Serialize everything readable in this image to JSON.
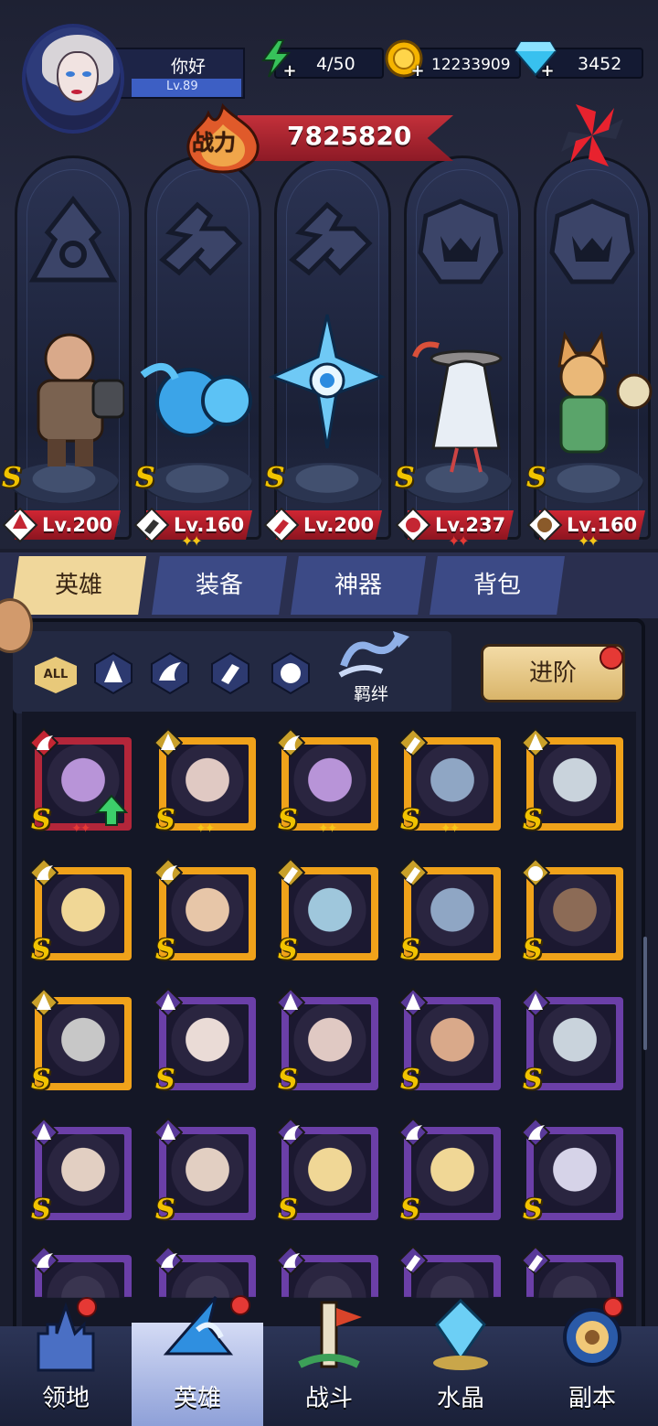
{
  "player": {
    "name": "你好",
    "level": "Lv.89"
  },
  "resources": {
    "energy": {
      "icon": "lightning-icon",
      "value": "4/50"
    },
    "gold": {
      "icon": "gold-coin-icon",
      "value": "12233909"
    },
    "diamond": {
      "icon": "diamond-icon",
      "value": "3452"
    }
  },
  "power": {
    "label": "战力",
    "value": "7825820"
  },
  "team": [
    {
      "slot_icon": "warrior-class-icon",
      "level": "Lv.200",
      "class_icon": "mage-class-icon",
      "stars": 0,
      "star_color": "#f5c518"
    },
    {
      "slot_icon": "engineer-class-icon",
      "level": "Lv.160",
      "class_icon": "wrench-class-icon",
      "stars": 2,
      "star_color": "#f5c518"
    },
    {
      "slot_icon": "engineer-class-icon",
      "level": "Lv.200",
      "class_icon": "wrench-class-icon",
      "stars": 0,
      "star_color": "#f5c518"
    },
    {
      "slot_icon": "beast-class-icon",
      "level": "Lv.237",
      "class_icon": "beast-class-icon",
      "stars": 2,
      "star_color": "#e53935"
    },
    {
      "slot_icon": "beast-class-icon",
      "level": "Lv.160",
      "class_icon": "beast-class-icon",
      "stars": 2,
      "star_color": "#f5c518"
    }
  ],
  "tabs": [
    {
      "label": "英雄",
      "active": true
    },
    {
      "label": "装备",
      "active": false
    },
    {
      "label": "神器",
      "active": false
    },
    {
      "label": "背包",
      "active": false
    }
  ],
  "filters": {
    "all_label": "ALL",
    "icons": [
      "mage-filter-icon",
      "wing-filter-icon",
      "wrench-filter-icon",
      "beast-filter-icon"
    ]
  },
  "bond_label": "羁绊",
  "advance_label": "进阶",
  "heroes": [
    {
      "name": "purple-hair-woman-portrait",
      "frame": "#b3263a",
      "class_icon": "wing-class-icon",
      "stars": 2,
      "star_color": "#e53935",
      "upgrade": true,
      "skin": "#b894d8"
    },
    {
      "name": "masked-ninja-woman-portrait",
      "frame": "#f0a21a",
      "class_icon": "mage-class-icon",
      "stars": 2,
      "star_color": "#f5c518",
      "upgrade": false,
      "skin": "#e0c9c3"
    },
    {
      "name": "purple-hair-woman-portrait",
      "frame": "#f0a21a",
      "class_icon": "wing-class-icon",
      "stars": 2,
      "star_color": "#f5c518",
      "upgrade": false,
      "skin": "#b894d8"
    },
    {
      "name": "robot-mech-portrait",
      "frame": "#f0a21a",
      "class_icon": "wrench-class-icon",
      "stars": 2,
      "star_color": "#f5c518",
      "upgrade": false,
      "skin": "#8fa6c4"
    },
    {
      "name": "silver-hair-man-portrait",
      "frame": "#f0a21a",
      "class_icon": "mage-class-icon",
      "stars": 0,
      "star_color": "#f5c518",
      "upgrade": false,
      "skin": "#c9d3dc"
    },
    {
      "name": "golden-elf-portrait",
      "frame": "#f0a21a",
      "class_icon": "wing-class-icon",
      "stars": 0,
      "star_color": "#f5c518",
      "upgrade": false,
      "skin": "#f0d796"
    },
    {
      "name": "green-hair-elf-portrait",
      "frame": "#f0a21a",
      "class_icon": "wing-class-icon",
      "stars": 0,
      "star_color": "#f5c518",
      "upgrade": false,
      "skin": "#e7c6a8"
    },
    {
      "name": "cyan-robot-portrait",
      "frame": "#f0a21a",
      "class_icon": "wrench-class-icon",
      "stars": 0,
      "star_color": "#f5c518",
      "upgrade": false,
      "skin": "#9fc7dc"
    },
    {
      "name": "robot-mech-portrait",
      "frame": "#f0a21a",
      "class_icon": "wrench-class-icon",
      "stars": 0,
      "star_color": "#f5c518",
      "upgrade": false,
      "skin": "#8fa6c4"
    },
    {
      "name": "ufo-saucer-portrait",
      "frame": "#f0a21a",
      "class_icon": "beast-class-icon",
      "stars": 0,
      "star_color": "#f5c518",
      "upgrade": false,
      "skin": "#8c6b56"
    },
    {
      "name": "armored-knight-portrait",
      "frame": "#f0a21a",
      "class_icon": "mage-class-icon",
      "stars": 0,
      "star_color": "#f5c518",
      "upgrade": false,
      "skin": "#c7c7c7"
    },
    {
      "name": "horned-white-hair-woman-portrait",
      "frame": "#6b3fa8",
      "class_icon": "mage-class-icon",
      "stars": 0,
      "star_color": "#f5c518",
      "upgrade": false,
      "skin": "#eadbd6"
    },
    {
      "name": "masked-ninja-woman-portrait",
      "frame": "#6b3fa8",
      "class_icon": "mage-class-icon",
      "stars": 0,
      "star_color": "#f5c518",
      "upgrade": false,
      "skin": "#e0c9c3"
    },
    {
      "name": "bald-warrior-portrait",
      "frame": "#6b3fa8",
      "class_icon": "mage-class-icon",
      "stars": 0,
      "star_color": "#f5c518",
      "upgrade": false,
      "skin": "#d9a98a"
    },
    {
      "name": "silver-hair-man-portrait",
      "frame": "#6b3fa8",
      "class_icon": "mage-class-icon",
      "stars": 0,
      "star_color": "#f5c518",
      "upgrade": false,
      "skin": "#c9d3dc"
    },
    {
      "name": "old-inventor-portrait",
      "frame": "#6b3fa8",
      "class_icon": "mage-class-icon",
      "stars": 0,
      "star_color": "#f5c518",
      "upgrade": false,
      "skin": "#e2cfc2"
    },
    {
      "name": "old-inventor-portrait",
      "frame": "#6b3fa8",
      "class_icon": "mage-class-icon",
      "stars": 0,
      "star_color": "#f5c518",
      "upgrade": false,
      "skin": "#e2cfc2"
    },
    {
      "name": "golden-elf-portrait",
      "frame": "#6b3fa8",
      "class_icon": "wing-class-icon",
      "stars": 0,
      "star_color": "#f5c518",
      "upgrade": false,
      "skin": "#f0d796"
    },
    {
      "name": "golden-elf-portrait",
      "frame": "#6b3fa8",
      "class_icon": "wing-class-icon",
      "stars": 0,
      "star_color": "#f5c518",
      "upgrade": false,
      "skin": "#f0d796"
    },
    {
      "name": "silver-hair-woman-portrait",
      "frame": "#6b3fa8",
      "class_icon": "wing-class-icon",
      "stars": 0,
      "star_color": "#f5c518",
      "upgrade": false,
      "skin": "#d6d3e8"
    },
    {
      "name": "hero-portrait-partial",
      "frame": "#6b3fa8",
      "class_icon": "wing-class-icon",
      "stars": 0,
      "star_color": "#f5c518",
      "upgrade": false,
      "skin": "#3a3550"
    },
    {
      "name": "hero-portrait-partial",
      "frame": "#6b3fa8",
      "class_icon": "wing-class-icon",
      "stars": 0,
      "star_color": "#f5c518",
      "upgrade": false,
      "skin": "#3a3550"
    },
    {
      "name": "hero-portrait-partial",
      "frame": "#6b3fa8",
      "class_icon": "wing-class-icon",
      "stars": 0,
      "star_color": "#f5c518",
      "upgrade": false,
      "skin": "#3a3550"
    },
    {
      "name": "hero-portrait-partial",
      "frame": "#6b3fa8",
      "class_icon": "wrench-class-icon",
      "stars": 0,
      "star_color": "#f5c518",
      "upgrade": false,
      "skin": "#3a3550"
    },
    {
      "name": "hero-portrait-partial",
      "frame": "#6b3fa8",
      "class_icon": "wrench-class-icon",
      "stars": 0,
      "star_color": "#f5c518",
      "upgrade": false,
      "skin": "#3a3550"
    }
  ],
  "nav": [
    {
      "label": "领地",
      "icon": "castle-icon",
      "active": false,
      "badge": true
    },
    {
      "label": "英雄",
      "icon": "wizard-hat-icon",
      "active": true,
      "badge": true
    },
    {
      "label": "战斗",
      "icon": "battle-banner-icon",
      "active": false,
      "badge": false
    },
    {
      "label": "水晶",
      "icon": "crystal-icon",
      "active": false,
      "badge": false
    },
    {
      "label": "副本",
      "icon": "portal-icon",
      "active": false,
      "badge": true
    }
  ],
  "colors": {
    "accent_gold": "#f1c300",
    "tab_active": "#f0d79b",
    "power_ribbon": "#c3303a",
    "badge_red": "#e53935"
  }
}
